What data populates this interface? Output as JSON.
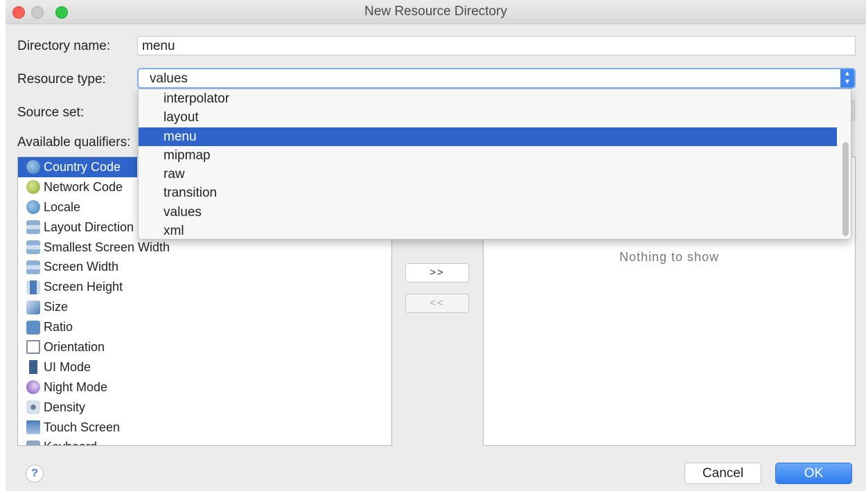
{
  "window": {
    "title": "New Resource Directory"
  },
  "form": {
    "directory_name_label": "Directory name:",
    "directory_name_value": "menu",
    "resource_type_label": "Resource type:",
    "resource_type_value": "values",
    "source_set_label": "Source set:",
    "available_qualifiers_label": "Available qualifiers:"
  },
  "resource_type_dropdown": {
    "options": [
      "interpolator",
      "layout",
      "menu",
      "mipmap",
      "raw",
      "transition",
      "values",
      "xml"
    ],
    "highlighted": "menu"
  },
  "qualifiers": {
    "items": [
      {
        "label": "Country Code",
        "icon": "globe-icon"
      },
      {
        "label": "Network Code",
        "icon": "network-icon"
      },
      {
        "label": "Locale",
        "icon": "globe-icon"
      },
      {
        "label": "Layout Direction",
        "icon": "layout-direction-icon"
      },
      {
        "label": "Smallest Screen Width",
        "icon": "smallest-width-icon"
      },
      {
        "label": "Screen Width",
        "icon": "screen-width-icon"
      },
      {
        "label": "Screen Height",
        "icon": "screen-height-icon"
      },
      {
        "label": "Size",
        "icon": "size-icon"
      },
      {
        "label": "Ratio",
        "icon": "ratio-icon"
      },
      {
        "label": "Orientation",
        "icon": "orientation-icon"
      },
      {
        "label": "UI Mode",
        "icon": "ui-mode-icon"
      },
      {
        "label": "Night Mode",
        "icon": "night-mode-icon"
      },
      {
        "label": "Density",
        "icon": "density-icon"
      },
      {
        "label": "Touch Screen",
        "icon": "touch-screen-icon"
      },
      {
        "label": "Keyboard",
        "icon": "keyboard-icon"
      }
    ],
    "selected": "Country Code"
  },
  "transfer": {
    "add_label": ">>",
    "remove_label": "<<"
  },
  "chosen": {
    "empty_text": "Nothing to show"
  },
  "footer": {
    "help_label": "?",
    "cancel_label": "Cancel",
    "ok_label": "OK"
  },
  "colors": {
    "selection": "#2f65ca",
    "accent": "#3d85f2",
    "close": "#fc5f57",
    "maximize": "#34c84a"
  }
}
